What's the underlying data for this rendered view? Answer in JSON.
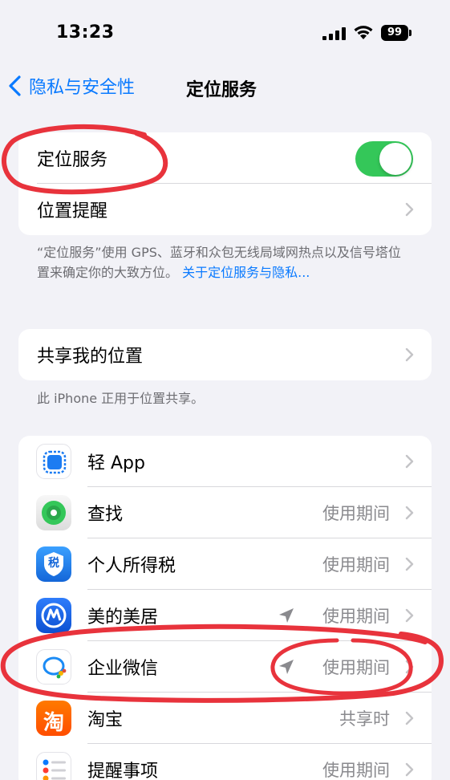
{
  "status_bar": {
    "time": "13:23",
    "battery": "99"
  },
  "nav": {
    "back_label": "隐私与安全性",
    "title": "定位服务"
  },
  "group1": {
    "location_services_label": "定位服务",
    "location_services_enabled": true,
    "location_alerts_label": "位置提醒"
  },
  "footer1": {
    "text": "“定位服务”使用 GPS、蓝牙和众包无线局域网热点以及信号塔位置来确定你的大致方位。",
    "link": "关于定位服务与隐私..."
  },
  "group2": {
    "share_label": "共享我的位置"
  },
  "footer2": {
    "text": "此 iPhone 正用于位置共享。"
  },
  "apps": [
    {
      "name": "轻 App",
      "value": "",
      "icon": "app-clip-icon",
      "recent_location": false
    },
    {
      "name": "查找",
      "value": "使用期间",
      "icon": "find-my-icon",
      "recent_location": false
    },
    {
      "name": "个人所得税",
      "value": "使用期间",
      "icon": "tax-app-icon",
      "recent_location": false
    },
    {
      "name": "美的美居",
      "value": "使用期间",
      "icon": "midea-icon",
      "recent_location": true
    },
    {
      "name": "企业微信",
      "value": "使用期间",
      "icon": "wecom-icon",
      "recent_location": true
    },
    {
      "name": "淘宝",
      "value": "共享时",
      "icon": "taobao-icon",
      "recent_location": false
    },
    {
      "name": "提醒事项",
      "value": "使用期间",
      "icon": "reminders-icon",
      "recent_location": false
    }
  ],
  "tax_icon_text": "税",
  "taobao_icon_text": "淘",
  "colors": {
    "accent": "#0a7aff",
    "toggle_on": "#34c759",
    "annotation": "#e8333c"
  }
}
